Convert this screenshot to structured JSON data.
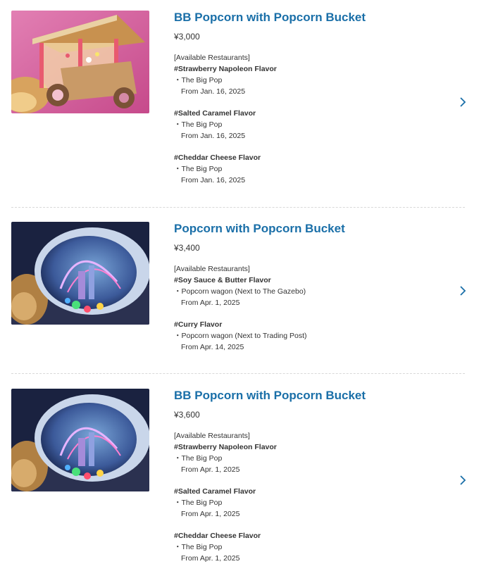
{
  "items": [
    {
      "title": "BB Popcorn with Popcorn Bucket",
      "price": "¥3,000",
      "available_label": "[Available Restaurants]",
      "image_desc": "gingerbread-cart-bucket",
      "flavors": [
        {
          "name": "#Strawberry Napoleon Flavor",
          "restaurant": "・The Big Pop",
          "from": "From Jan. 16, 2025"
        },
        {
          "name": "#Salted Caramel Flavor",
          "restaurant": "・The Big Pop",
          "from": "From Jan. 16, 2025"
        },
        {
          "name": "#Cheddar Cheese Flavor",
          "restaurant": "・The Big Pop",
          "from": "From Jan. 16, 2025"
        }
      ]
    },
    {
      "title": "Popcorn with Popcorn Bucket",
      "price": "¥3,400",
      "available_label": "[Available Restaurants]",
      "image_desc": "light-up-dome-bucket",
      "flavors": [
        {
          "name": "#Soy Sauce & Butter Flavor",
          "restaurant": "・Popcorn wagon (Next to The Gazebo)",
          "from": "From Apr. 1, 2025"
        },
        {
          "name": "#Curry Flavor",
          "restaurant": "・Popcorn wagon (Next to Trading Post)",
          "from": "From Apr. 14, 2025"
        }
      ]
    },
    {
      "title": "BB Popcorn with Popcorn Bucket",
      "price": "¥3,600",
      "available_label": "[Available Restaurants]",
      "image_desc": "light-up-dome-bucket",
      "flavors": [
        {
          "name": "#Strawberry Napoleon Flavor",
          "restaurant": "・The Big Pop",
          "from": "From Apr. 1, 2025"
        },
        {
          "name": "#Salted Caramel Flavor",
          "restaurant": "・The Big Pop",
          "from": "From Apr. 1, 2025"
        },
        {
          "name": "#Cheddar Cheese Flavor",
          "restaurant": "・The Big Pop",
          "from": "From Apr. 1, 2025"
        }
      ]
    }
  ],
  "colors": {
    "title": "#1a6fa8",
    "text": "#333333",
    "divider": "#d9d9d9",
    "chevron": "#1a6fa8"
  }
}
